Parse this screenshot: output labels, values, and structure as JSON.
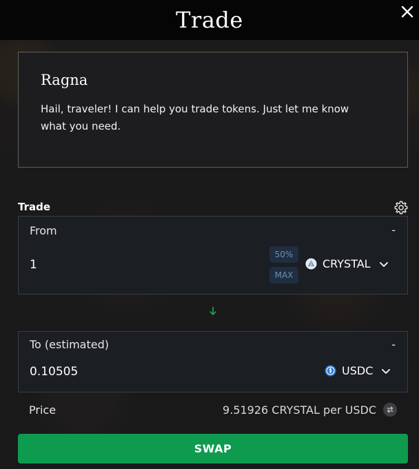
{
  "header": {
    "title": "Trade"
  },
  "dialog": {
    "speaker": "Ragna",
    "message": "Hail, traveler! I can help you trade tokens. Just let me know what you need."
  },
  "trade": {
    "label": "Trade",
    "from": {
      "label": "From",
      "dash": "-",
      "amount": "1",
      "half_label": "50%",
      "max_label": "MAX",
      "token": "CRYSTAL",
      "token_icon": "crystal-icon"
    },
    "to": {
      "label": "To (estimated)",
      "dash": "-",
      "amount": "0.10505",
      "token": "USDC",
      "token_icon": "usdc-icon"
    },
    "price": {
      "label": "Price",
      "value": "9.51926 CRYSTAL per USDC"
    },
    "swap_label": "SWAP"
  },
  "colors": {
    "accent": "#0e9b4f",
    "arrow": "#18b45b",
    "usdc": "#2775ca"
  }
}
